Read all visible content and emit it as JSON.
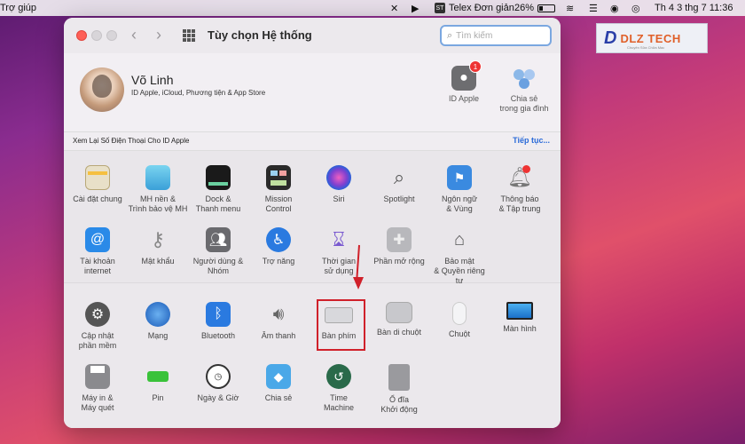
{
  "menubar": {
    "app_menu": "Trợ giúp",
    "input_source": "Telex Đơn giản",
    "input_source_short": "ST",
    "battery": "26%",
    "clock": "Th 4 3 thg 7  11:36"
  },
  "watermark": {
    "logo": "D",
    "brand": "DLZ TECH",
    "tagline": "Chuyên Sửa Chữa Mac"
  },
  "window": {
    "title": "Tùy chọn Hệ thống",
    "search_placeholder": "Tìm kiếm"
  },
  "profile": {
    "name": "Võ Linh",
    "subtitle": "ID Apple, iCloud, Phương tiện & App Store",
    "apple_id": {
      "label": "ID Apple",
      "badge": "1"
    },
    "family": {
      "label": "Chia sẻ\ntrong gia đình"
    }
  },
  "notice": {
    "text": "Xem Lại Số Điện Thoại Cho ID Apple",
    "link": "Tiếp tục..."
  },
  "panes": [
    {
      "id": "general",
      "label": "Cài đặt chung"
    },
    {
      "id": "desktop",
      "label": "MH nền &\nTrình bảo vệ MH"
    },
    {
      "id": "dock",
      "label": "Dock &\nThanh menu"
    },
    {
      "id": "mission",
      "label": "Mission\nControl"
    },
    {
      "id": "siri",
      "label": "Siri"
    },
    {
      "id": "spotlight",
      "label": "Spotlight"
    },
    {
      "id": "language",
      "label": "Ngôn ngữ\n& Vùng"
    },
    {
      "id": "notifications",
      "label": "Thông báo\n& Tập trung"
    },
    {
      "id": "internet",
      "label": "Tài khoản\ninternet"
    },
    {
      "id": "passwords",
      "label": "Mật khẩu"
    },
    {
      "id": "users",
      "label": "Người dùng &\nNhóm"
    },
    {
      "id": "accessibility",
      "label": "Trợ năng"
    },
    {
      "id": "screentime",
      "label": "Thời gian\nsử dụng"
    },
    {
      "id": "extensions",
      "label": "Phần mở rộng"
    },
    {
      "id": "security",
      "label": "Bảo mật\n& Quyền riêng tư"
    },
    {
      "id": "update",
      "label": "Cập nhật\nphần mềm"
    },
    {
      "id": "network",
      "label": "Mạng"
    },
    {
      "id": "bluetooth",
      "label": "Bluetooth"
    },
    {
      "id": "sound",
      "label": "Âm thanh"
    },
    {
      "id": "keyboard",
      "label": "Bàn phím"
    },
    {
      "id": "trackpad",
      "label": "Bàn di chuột"
    },
    {
      "id": "mouse",
      "label": "Chuột"
    },
    {
      "id": "display",
      "label": "Màn hình"
    },
    {
      "id": "printers",
      "label": "Máy in &\nMáy quét"
    },
    {
      "id": "battery",
      "label": "Pin"
    },
    {
      "id": "datetime",
      "label": "Ngày & Giờ"
    },
    {
      "id": "sharing",
      "label": "Chia sẻ"
    },
    {
      "id": "timemachine",
      "label": "Time\nMachine"
    },
    {
      "id": "startup",
      "label": "Ổ đĩa\nKhởi động"
    }
  ]
}
